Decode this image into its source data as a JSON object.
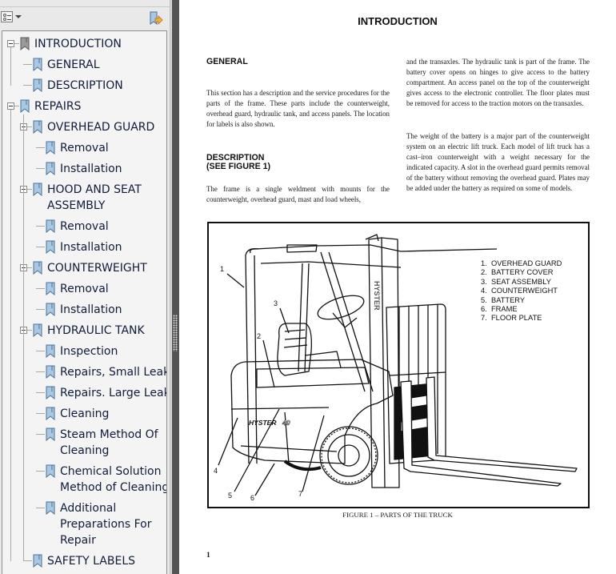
{
  "sidebar": {
    "options_button": "bookmark-options",
    "find_bookmark_button": "expand-current-bookmark",
    "bookmarks": [
      {
        "label": "INTRODUCTION",
        "level": 0,
        "expanded": true
      },
      {
        "label": "GENERAL",
        "level": 1
      },
      {
        "label": "DESCRIPTION",
        "level": 1
      },
      {
        "label": "REPAIRS",
        "level": 0,
        "expanded": true
      },
      {
        "label": "OVERHEAD GUARD",
        "level": 1,
        "expanded": true
      },
      {
        "label": "Removal",
        "level": 2
      },
      {
        "label": "Installation",
        "level": 2
      },
      {
        "label": "HOOD AND SEAT",
        "label2": "ASSEMBLY",
        "level": 1,
        "expanded": true
      },
      {
        "label": "Removal",
        "level": 2
      },
      {
        "label": "Installation",
        "level": 2
      },
      {
        "label": "COUNTERWEIGHT",
        "level": 1,
        "expanded": true
      },
      {
        "label": "Removal",
        "level": 2
      },
      {
        "label": "Installation",
        "level": 2
      },
      {
        "label": "HYDRAULIC TANK",
        "level": 1,
        "expanded": true
      },
      {
        "label": "Inspection",
        "level": 2
      },
      {
        "label": "Repairs, Small Leaks",
        "level": 2
      },
      {
        "label": "Repairs. Large Leaks",
        "level": 2
      },
      {
        "label": "Cleaning",
        "level": 2
      },
      {
        "label": "Steam Method Of",
        "label2": "Cleaning",
        "level": 2
      },
      {
        "label": "Chemical Solution",
        "label2": "Method of Cleaning",
        "level": 2
      },
      {
        "label": "Additional",
        "label2": "Preparations For",
        "label3": "Repair",
        "level": 2
      },
      {
        "label": "SAFETY LABELS",
        "level": 1
      }
    ]
  },
  "document": {
    "title": "INTRODUCTION",
    "general_heading": "GENERAL",
    "general_text": "This section has a description and the service procedures for the parts of the frame. These parts include the counterweight, overhead guard, hydraulic tank, and access panels. The location for labels is also shown.",
    "description_heading_1": "DESCRIPTION",
    "description_heading_2": "(SEE FIGURE 1)",
    "description_text": "The frame is a single weldment with mounts for the counterweight, overhead guard, mast and load wheels,",
    "col2_text_1": "and the transaxles. The hydraulic tank is part of the frame. The battery cover opens on hinges to give access to the battery compartment. An access panel on the top of the counterweight gives access to the electronic controller. The floor plates must be removed for access to the traction motors on the transaxles.",
    "col2_text_2": "The weight of the battery is a major part of the counterweight system on an electric lift truck. Each model of lift truck has a cast–iron counterweight with a weight necessary for the indicated capacity. A slot in the overhead guard permits removal of the battery without removing the overhead guard. Plates may be added under the battery as required on some of models.",
    "figure": {
      "legend": [
        {
          "num": "1.",
          "text": "OVERHEAD GUARD"
        },
        {
          "num": "2.",
          "text": "BATTERY COVER"
        },
        {
          "num": "3.",
          "text": "SEAT ASSEMBLY"
        },
        {
          "num": "4.",
          "text": "COUNTERWEIGHT"
        },
        {
          "num": "5.",
          "text": "BATTERY"
        },
        {
          "num": "6.",
          "text": "FRAME"
        },
        {
          "num": "7.",
          "text": "FLOOR PLATE"
        }
      ],
      "callouts": [
        "1",
        "2",
        "3",
        "4",
        "5",
        "6",
        "7"
      ],
      "mast_brand": "HYSTER",
      "body_brand": "HYSTER",
      "body_model": "40",
      "caption": "FIGURE 1 – PARTS OF THE TRUCK"
    },
    "page_number": "1"
  }
}
